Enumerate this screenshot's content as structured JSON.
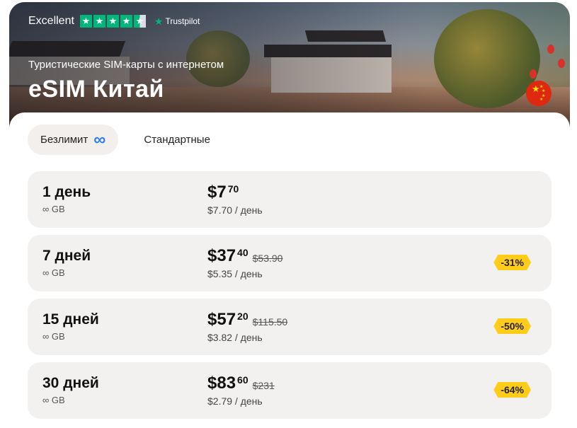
{
  "rating": {
    "label": "Excellent",
    "provider": "Trustpilot",
    "stars": 4.5
  },
  "hero": {
    "subtitle": "Туристические SIM-карты с интернетом",
    "title": "eSIM Китай",
    "flag_icon": "china-flag-icon"
  },
  "tabs": [
    {
      "label": "Безлимит",
      "active": true,
      "icon": "infinity-icon"
    },
    {
      "label": "Стандартные",
      "active": false
    }
  ],
  "colors": {
    "accent_green": "#00b67a",
    "badge_yellow": "#ffcc1a",
    "infinity_blue": "#2f7ef0",
    "card_bg": "#f3f1ef"
  },
  "plans": [
    {
      "name": "1 день",
      "gb": "∞ GB",
      "price": "$7",
      "cents": "70",
      "old_price": "",
      "per_day": "$7.70 / день",
      "discount": ""
    },
    {
      "name": "7 дней",
      "gb": "∞ GB",
      "price": "$37",
      "cents": "40",
      "old_price": "$53.90",
      "per_day": "$5.35 / день",
      "discount": "-31%"
    },
    {
      "name": "15 дней",
      "gb": "∞ GB",
      "price": "$57",
      "cents": "20",
      "old_price": "$115.50",
      "per_day": "$3.82 / день",
      "discount": "-50%"
    },
    {
      "name": "30 дней",
      "gb": "∞ GB",
      "price": "$83",
      "cents": "60",
      "old_price": "$231",
      "per_day": "$2.79 / день",
      "discount": "-64%"
    }
  ]
}
